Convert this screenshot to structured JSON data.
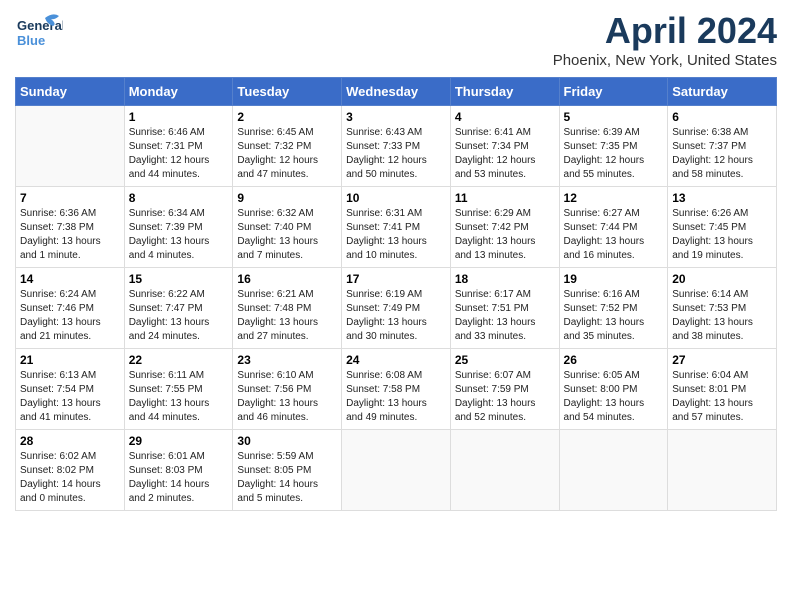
{
  "header": {
    "logo_general": "General",
    "logo_blue": "Blue",
    "title": "April 2024",
    "location": "Phoenix, New York, United States"
  },
  "calendar": {
    "days_of_week": [
      "Sunday",
      "Monday",
      "Tuesday",
      "Wednesday",
      "Thursday",
      "Friday",
      "Saturday"
    ],
    "weeks": [
      [
        {
          "day": "",
          "info": ""
        },
        {
          "day": "1",
          "info": "Sunrise: 6:46 AM\nSunset: 7:31 PM\nDaylight: 12 hours\nand 44 minutes."
        },
        {
          "day": "2",
          "info": "Sunrise: 6:45 AM\nSunset: 7:32 PM\nDaylight: 12 hours\nand 47 minutes."
        },
        {
          "day": "3",
          "info": "Sunrise: 6:43 AM\nSunset: 7:33 PM\nDaylight: 12 hours\nand 50 minutes."
        },
        {
          "day": "4",
          "info": "Sunrise: 6:41 AM\nSunset: 7:34 PM\nDaylight: 12 hours\nand 53 minutes."
        },
        {
          "day": "5",
          "info": "Sunrise: 6:39 AM\nSunset: 7:35 PM\nDaylight: 12 hours\nand 55 minutes."
        },
        {
          "day": "6",
          "info": "Sunrise: 6:38 AM\nSunset: 7:37 PM\nDaylight: 12 hours\nand 58 minutes."
        }
      ],
      [
        {
          "day": "7",
          "info": "Sunrise: 6:36 AM\nSunset: 7:38 PM\nDaylight: 13 hours\nand 1 minute."
        },
        {
          "day": "8",
          "info": "Sunrise: 6:34 AM\nSunset: 7:39 PM\nDaylight: 13 hours\nand 4 minutes."
        },
        {
          "day": "9",
          "info": "Sunrise: 6:32 AM\nSunset: 7:40 PM\nDaylight: 13 hours\nand 7 minutes."
        },
        {
          "day": "10",
          "info": "Sunrise: 6:31 AM\nSunset: 7:41 PM\nDaylight: 13 hours\nand 10 minutes."
        },
        {
          "day": "11",
          "info": "Sunrise: 6:29 AM\nSunset: 7:42 PM\nDaylight: 13 hours\nand 13 minutes."
        },
        {
          "day": "12",
          "info": "Sunrise: 6:27 AM\nSunset: 7:44 PM\nDaylight: 13 hours\nand 16 minutes."
        },
        {
          "day": "13",
          "info": "Sunrise: 6:26 AM\nSunset: 7:45 PM\nDaylight: 13 hours\nand 19 minutes."
        }
      ],
      [
        {
          "day": "14",
          "info": "Sunrise: 6:24 AM\nSunset: 7:46 PM\nDaylight: 13 hours\nand 21 minutes."
        },
        {
          "day": "15",
          "info": "Sunrise: 6:22 AM\nSunset: 7:47 PM\nDaylight: 13 hours\nand 24 minutes."
        },
        {
          "day": "16",
          "info": "Sunrise: 6:21 AM\nSunset: 7:48 PM\nDaylight: 13 hours\nand 27 minutes."
        },
        {
          "day": "17",
          "info": "Sunrise: 6:19 AM\nSunset: 7:49 PM\nDaylight: 13 hours\nand 30 minutes."
        },
        {
          "day": "18",
          "info": "Sunrise: 6:17 AM\nSunset: 7:51 PM\nDaylight: 13 hours\nand 33 minutes."
        },
        {
          "day": "19",
          "info": "Sunrise: 6:16 AM\nSunset: 7:52 PM\nDaylight: 13 hours\nand 35 minutes."
        },
        {
          "day": "20",
          "info": "Sunrise: 6:14 AM\nSunset: 7:53 PM\nDaylight: 13 hours\nand 38 minutes."
        }
      ],
      [
        {
          "day": "21",
          "info": "Sunrise: 6:13 AM\nSunset: 7:54 PM\nDaylight: 13 hours\nand 41 minutes."
        },
        {
          "day": "22",
          "info": "Sunrise: 6:11 AM\nSunset: 7:55 PM\nDaylight: 13 hours\nand 44 minutes."
        },
        {
          "day": "23",
          "info": "Sunrise: 6:10 AM\nSunset: 7:56 PM\nDaylight: 13 hours\nand 46 minutes."
        },
        {
          "day": "24",
          "info": "Sunrise: 6:08 AM\nSunset: 7:58 PM\nDaylight: 13 hours\nand 49 minutes."
        },
        {
          "day": "25",
          "info": "Sunrise: 6:07 AM\nSunset: 7:59 PM\nDaylight: 13 hours\nand 52 minutes."
        },
        {
          "day": "26",
          "info": "Sunrise: 6:05 AM\nSunset: 8:00 PM\nDaylight: 13 hours\nand 54 minutes."
        },
        {
          "day": "27",
          "info": "Sunrise: 6:04 AM\nSunset: 8:01 PM\nDaylight: 13 hours\nand 57 minutes."
        }
      ],
      [
        {
          "day": "28",
          "info": "Sunrise: 6:02 AM\nSunset: 8:02 PM\nDaylight: 14 hours\nand 0 minutes."
        },
        {
          "day": "29",
          "info": "Sunrise: 6:01 AM\nSunset: 8:03 PM\nDaylight: 14 hours\nand 2 minutes."
        },
        {
          "day": "30",
          "info": "Sunrise: 5:59 AM\nSunset: 8:05 PM\nDaylight: 14 hours\nand 5 minutes."
        },
        {
          "day": "",
          "info": ""
        },
        {
          "day": "",
          "info": ""
        },
        {
          "day": "",
          "info": ""
        },
        {
          "day": "",
          "info": ""
        }
      ]
    ]
  }
}
